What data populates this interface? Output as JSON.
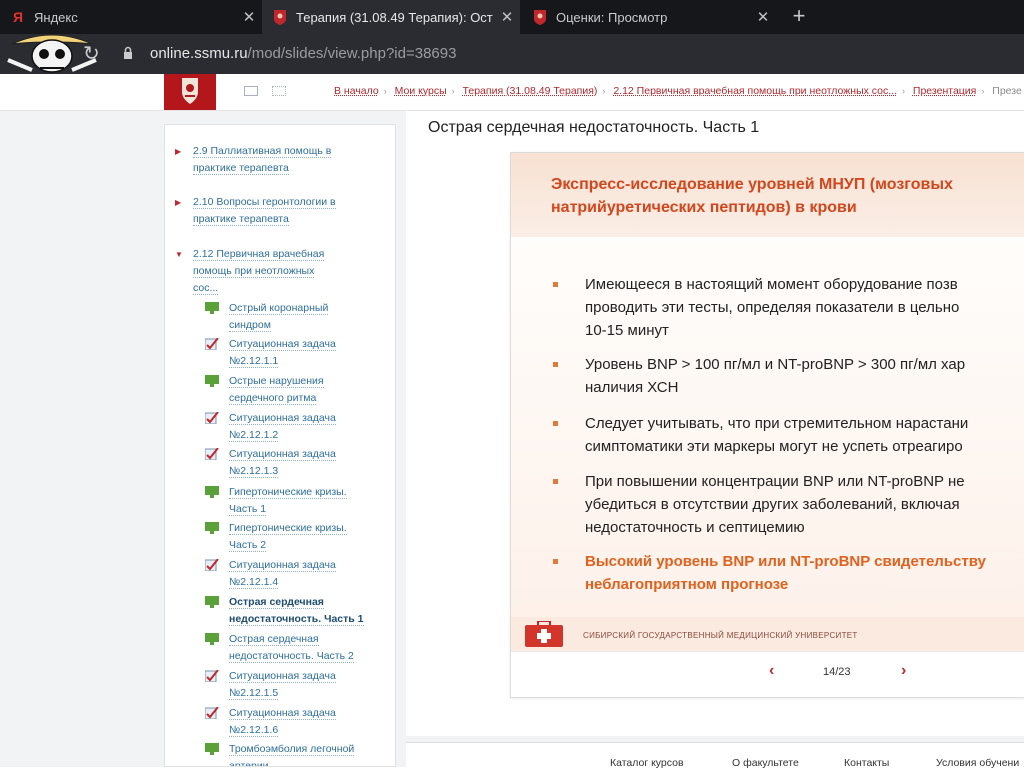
{
  "browser": {
    "tabs": [
      {
        "label": "Яндекс",
        "icon": "yandex-icon"
      },
      {
        "label": "Терапия (31.08.49 Терапия): Ост",
        "icon": "ssmu-icon"
      },
      {
        "label": "Оценки: Просмотр",
        "icon": "ssmu-icon"
      }
    ],
    "url_host": "online.ssmu.ru",
    "url_path": "/mod/slides/view.php?id=38693"
  },
  "breadcrumb": [
    "В начало",
    "Мои курсы",
    "Терапия (31.08.49 Терапия)",
    "2.12 Первичная врачебная помощь при неотложных сос...",
    "Презентация"
  ],
  "breadcrumb_last": "Презе",
  "sidebar": {
    "sections": [
      {
        "label": "2.9 Паллиативная помощь в практике терапевта"
      },
      {
        "label": "2.10 Вопросы геронтологии в практике терапевта"
      },
      {
        "label": "2.12 Первичная врачебная помощь при неотложных сос..."
      }
    ],
    "items": [
      {
        "label": "Острый коронарный синдром",
        "type": "slides"
      },
      {
        "label": "Ситуационная задача №2.12.1.1",
        "type": "quiz"
      },
      {
        "label": "Острые нарушения сердечного ритма",
        "type": "slides"
      },
      {
        "label": "Ситуационная задача №2.12.1.2",
        "type": "quiz"
      },
      {
        "label": "Ситуационная задача №2.12.1.3",
        "type": "quiz"
      },
      {
        "label": "Гипертонические кризы. Часть 1",
        "type": "slides"
      },
      {
        "label": "Гипертонические кризы. Часть 2",
        "type": "slides"
      },
      {
        "label": "Ситуационная задача №2.12.1.4",
        "type": "quiz"
      },
      {
        "label": "Острая сердечная недостаточность. Часть 1",
        "type": "slides"
      },
      {
        "label": "Острая сердечная недостаточность. Часть 2",
        "type": "slides"
      },
      {
        "label": "Ситуационная задача №2.12.1.5",
        "type": "quiz"
      },
      {
        "label": "Ситуационная задача №2.12.1.6",
        "type": "quiz"
      },
      {
        "label": "Тромбоэмболия легочной артерии",
        "type": "slides"
      }
    ]
  },
  "page": {
    "title": "Острая сердечная недостаточность. Часть 1"
  },
  "slide": {
    "title_line1": "Экспресс-исследование уровней МНУП (мозговых",
    "title_line2": "натрийуретических пептидов) в крови",
    "bullets": [
      {
        "lines": [
          "Имеющееся в настоящий момент оборудование позв",
          "проводить эти тесты, определяя показатели в цельно",
          "10-15 минут"
        ]
      },
      {
        "lines": [
          "Уровень BNP > 100 пг/мл и NT-proBNP > 300 пг/мл хар",
          "наличия ХСН"
        ]
      },
      {
        "lines": [
          "Следует учитывать, что при стремительном нарастани",
          "симптоматики эти маркеры могут не успеть отреагиро"
        ]
      },
      {
        "lines": [
          "При повышении концентрации BNP или NT-proBNP не",
          "убедиться в отсутствии других заболеваний, включая",
          "недостаточность и септицемию"
        ]
      },
      {
        "lines": [
          "Высокий уровень BNP или NT-proBNP свидетельству",
          "неблагоприятном прогнозе"
        ]
      }
    ],
    "university": "СИБИРСКИЙ ГОСУДАРСТВЕННЫЙ МЕДИЦИНСКИЙ УНИВЕРСИТЕТ",
    "page_indicator": "14/23"
  },
  "footer_nav": [
    "Каталог курсов",
    "О факультете",
    "Контакты",
    "Условия обучени"
  ],
  "colors": {
    "brand_red": "#b3161b",
    "link_blue": "#2f6f9a",
    "slide_orange": "#d4461c"
  }
}
